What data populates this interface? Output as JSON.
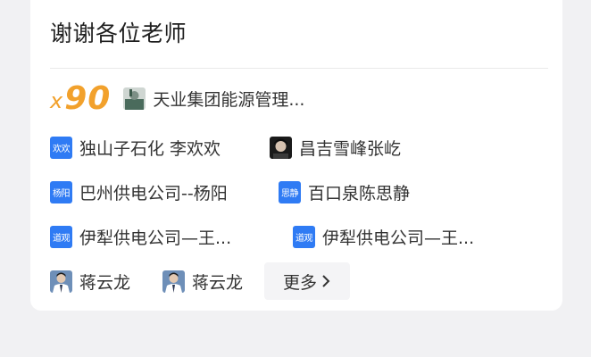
{
  "card": {
    "title": "谢谢各位老师"
  },
  "reward": {
    "prefix": "x",
    "count": "90",
    "giver": "天业集团能源管理..."
  },
  "thanks": [
    {
      "badge": "欢欢",
      "name": "独山子石化 李欢欢"
    },
    {
      "badge": "",
      "name": "昌吉雪峰张屹"
    },
    {
      "badge": "杨阳",
      "name": "巴州供电公司--杨阳"
    },
    {
      "badge": "思静",
      "name": "百口泉陈思静"
    },
    {
      "badge": "道观",
      "name": "伊犁供电公司—王..."
    },
    {
      "badge": "道观",
      "name": "伊犁供电公司—王..."
    },
    {
      "badge": "",
      "name": "蒋云龙"
    },
    {
      "badge": "",
      "name": "蒋云龙"
    }
  ],
  "more_label": "更多",
  "colors": {
    "accent_orange": "#f2a12c",
    "badge_blue": "#2f7bf4",
    "text": "#333333"
  },
  "icons": {
    "more": "chevron-right-icon"
  }
}
